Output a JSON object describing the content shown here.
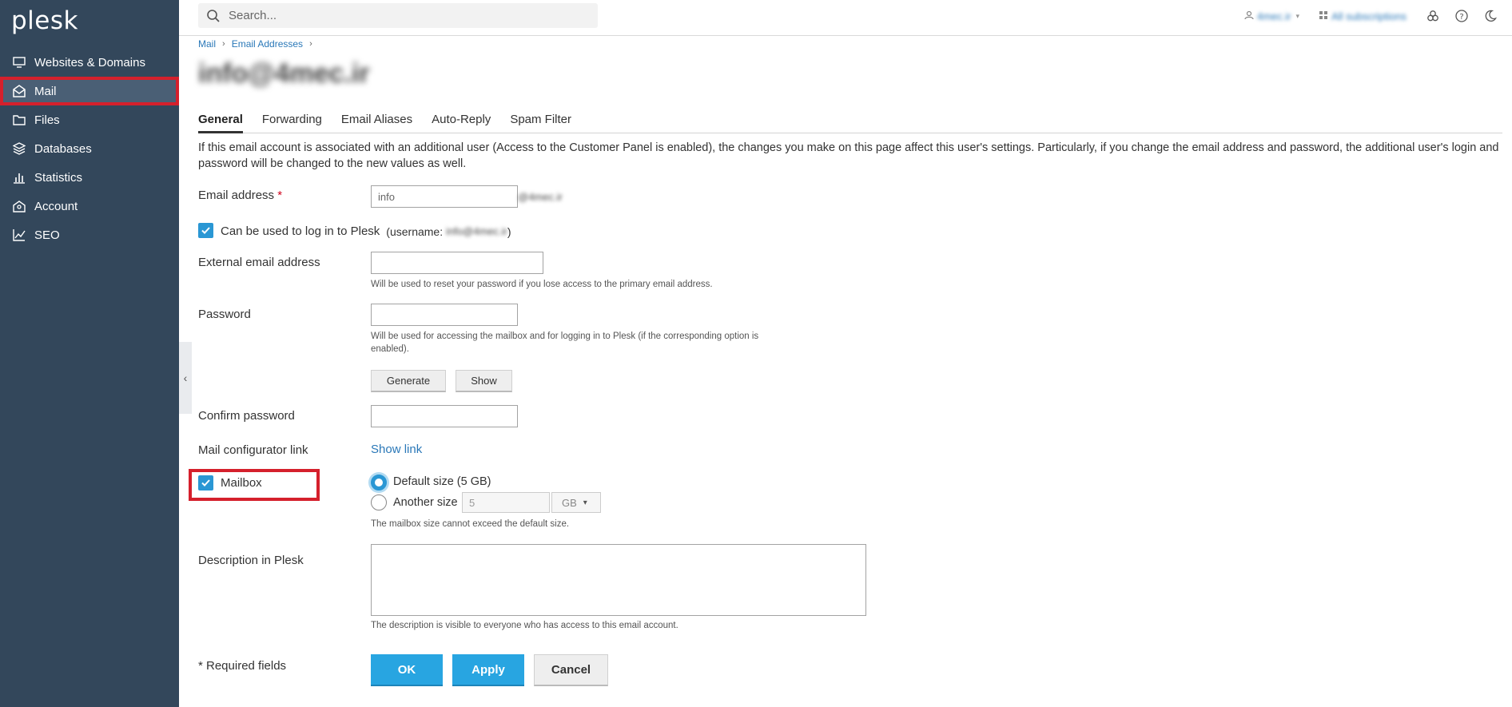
{
  "app": {
    "logo": "plesk"
  },
  "sidebar": {
    "items": [
      {
        "label": "Websites & Domains",
        "icon": "monitor-icon"
      },
      {
        "label": "Mail",
        "icon": "envelope-icon",
        "active": true
      },
      {
        "label": "Files",
        "icon": "folder-icon"
      },
      {
        "label": "Databases",
        "icon": "database-stack-icon"
      },
      {
        "label": "Statistics",
        "icon": "bar-chart-icon"
      },
      {
        "label": "Account",
        "icon": "account-icon"
      },
      {
        "label": "SEO",
        "icon": "seo-chart-icon"
      }
    ]
  },
  "topbar": {
    "search_placeholder": "Search...",
    "user": "4mec.ir",
    "subscriptions": "All subscriptions"
  },
  "breadcrumb": {
    "items": [
      "Mail",
      "Email Addresses"
    ]
  },
  "page": {
    "title": "info@4mec.ir"
  },
  "tabs": [
    "General",
    "Forwarding",
    "Email Aliases",
    "Auto-Reply",
    "Spam Filter"
  ],
  "intro_text": "If this email account is associated with an additional user (Access to the Customer Panel is enabled), the changes you make on this page affect this user's settings. Particularly, if you change the email address and password, the additional user's login and password will be changed to the new values as well.",
  "form": {
    "email_label": "Email address",
    "required_mark": "*",
    "email_value": "info",
    "email_domain": "@4mec.ir",
    "login_checkbox_label": "Can be used to log in to Plesk",
    "username_prefix": "(username:",
    "username_value": "info@4mec.ir",
    "username_suffix": ")",
    "external_label": "External email address",
    "external_hint": "Will be used to reset your password if you lose access to the primary email address.",
    "password_label": "Password",
    "password_hint": "Will be used for accessing the mailbox and for logging in to Plesk (if the corresponding option is enabled).",
    "generate_label": "Generate",
    "show_label": "Show",
    "confirm_label": "Confirm password",
    "configurator_label": "Mail configurator link",
    "show_link_label": "Show link",
    "mailbox_label": "Mailbox",
    "default_size_label": "Default size (5 GB)",
    "another_size_label": "Another size",
    "another_size_value": "5",
    "size_unit": "GB",
    "mailbox_hint": "The mailbox size cannot exceed the default size.",
    "description_label": "Description in Plesk",
    "description_hint": "The description is visible to everyone who has access to this email account.",
    "required_fields_label": "* Required fields"
  },
  "actions": {
    "ok": "OK",
    "apply": "Apply",
    "cancel": "Cancel"
  }
}
